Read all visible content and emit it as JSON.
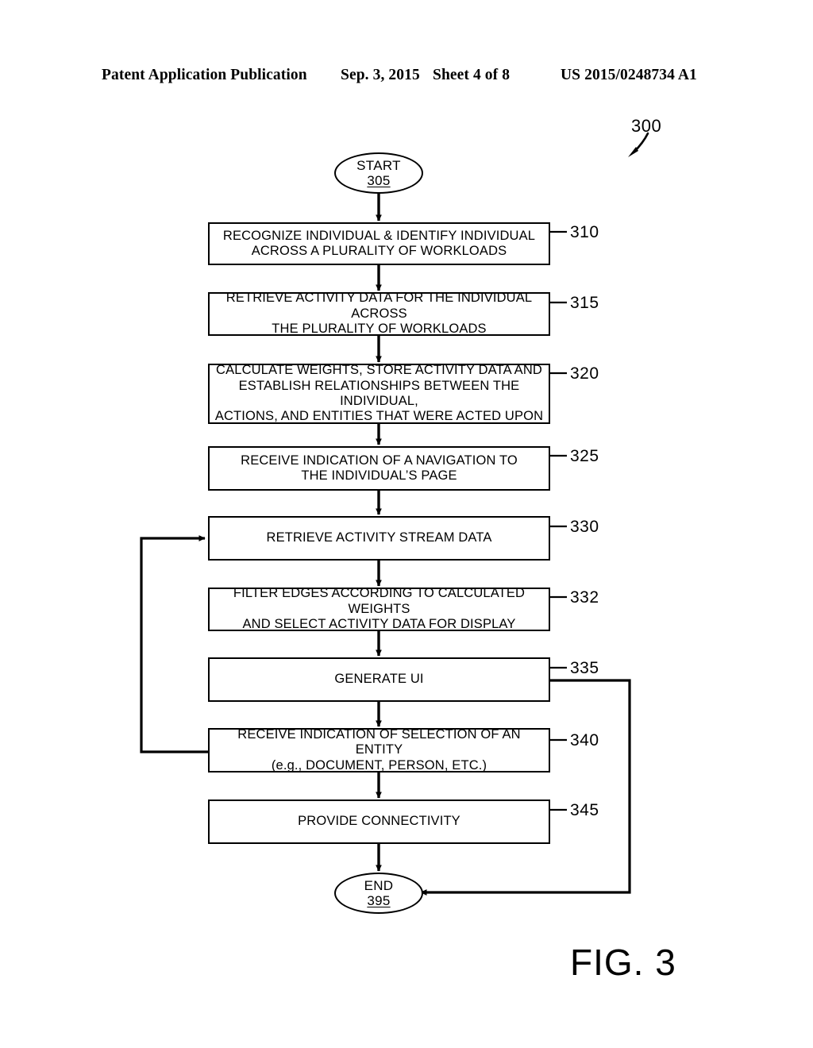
{
  "header": {
    "publication": "Patent Application Publication",
    "date": "Sep. 3, 2015",
    "sheet": "Sheet 4 of 8",
    "patent_number": "US 2015/0248734 A1"
  },
  "figure": {
    "caption": "FIG. 3",
    "reference": "300"
  },
  "flowchart": {
    "start": {
      "label": "START",
      "number": "305"
    },
    "end": {
      "label": "END",
      "number": "395"
    },
    "steps": [
      {
        "ref": "310",
        "text": "RECOGNIZE INDIVIDUAL & IDENTIFY INDIVIDUAL\nACROSS A PLURALITY OF WORKLOADS"
      },
      {
        "ref": "315",
        "text": "RETRIEVE ACTIVITY DATA FOR THE INDIVIDUAL ACROSS\nTHE PLURALITY OF WORKLOADS"
      },
      {
        "ref": "320",
        "text": "CALCULATE WEIGHTS, STORE ACTIVITY DATA AND\nESTABLISH RELATIONSHIPS BETWEEN THE INDIVIDUAL,\nACTIONS, AND ENTITIES THAT WERE ACTED UPON"
      },
      {
        "ref": "325",
        "text": "RECEIVE INDICATION OF A NAVIGATION TO\nTHE INDIVIDUAL’S PAGE"
      },
      {
        "ref": "330",
        "text": "RETRIEVE ACTIVITY STREAM DATA"
      },
      {
        "ref": "332",
        "text": "FILTER EDGES ACCORDING TO CALCULATED WEIGHTS\nAND SELECT ACTIVITY DATA FOR DISPLAY"
      },
      {
        "ref": "335",
        "text": "GENERATE UI"
      },
      {
        "ref": "340",
        "text": "RECEIVE INDICATION OF SELECTION OF AN ENTITY\n(e.g., DOCUMENT, PERSON, ETC.)"
      },
      {
        "ref": "345",
        "text": "PROVIDE CONNECTIVITY"
      }
    ]
  },
  "colors": {
    "ink": "#000000",
    "paper": "#ffffff"
  }
}
